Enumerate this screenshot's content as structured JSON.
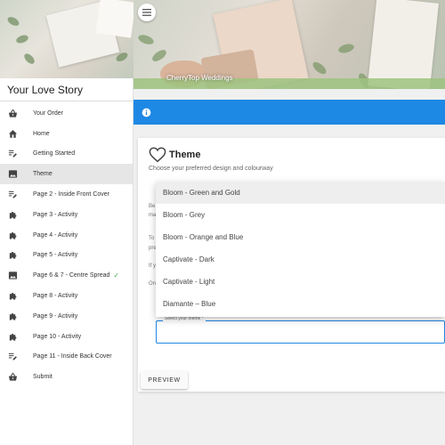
{
  "sidebar": {
    "title": "Your Love Story",
    "items": [
      {
        "label": "Your Order",
        "icon": "basket-icon",
        "active": false,
        "complete": false
      },
      {
        "label": "Home",
        "icon": "home-icon",
        "active": false,
        "complete": false
      },
      {
        "label": "Getting Started",
        "icon": "playlist-edit-icon",
        "active": false,
        "complete": false
      },
      {
        "label": "Theme",
        "icon": "image-icon",
        "active": true,
        "complete": false
      },
      {
        "label": "Page 2 - Inside Front Cover",
        "icon": "playlist-edit-icon",
        "active": false,
        "complete": false
      },
      {
        "label": "Page 3 - Activity",
        "icon": "puzzle-icon",
        "active": false,
        "complete": false
      },
      {
        "label": "Page 4 - Activity",
        "icon": "puzzle-icon",
        "active": false,
        "complete": false
      },
      {
        "label": "Page 5 - Activity",
        "icon": "puzzle-icon",
        "active": false,
        "complete": false
      },
      {
        "label": "Page 6 & 7 - Centre Spread",
        "icon": "image-icon",
        "active": false,
        "complete": true
      },
      {
        "label": "Page 8 - Activity",
        "icon": "puzzle-icon",
        "active": false,
        "complete": false
      },
      {
        "label": "Page 9 - Activity",
        "icon": "puzzle-icon",
        "active": false,
        "complete": false
      },
      {
        "label": "Page 10 - Activity",
        "icon": "puzzle-icon",
        "active": false,
        "complete": false
      },
      {
        "label": "Page 11 - Inside Back Cover",
        "icon": "playlist-edit-icon",
        "active": false,
        "complete": false
      },
      {
        "label": "Submit",
        "icon": "basket-icon",
        "active": false,
        "complete": false
      }
    ],
    "check_mark": "✓"
  },
  "header": {
    "brand": "CherryTop Weddings"
  },
  "theme": {
    "title": "Theme",
    "subtitle": "Choose your preferred design and colourway",
    "body_fragments": [
      "Be",
      "ma",
      "To",
      "pre",
      "If y",
      "On"
    ],
    "select_label": "Select your theme *",
    "options": [
      "Bloom - Green and Gold",
      "Bloom - Grey",
      "Bloom - Orange and Blue",
      "Captivate - Dark",
      "Captivate - Light",
      "Diamante – Blue"
    ],
    "highlighted_option": 0,
    "preview_label": "PREVIEW"
  },
  "colors": {
    "accent": "#1e88e5",
    "complete": "#4caf50",
    "active_bg": "#e6e6e6"
  }
}
